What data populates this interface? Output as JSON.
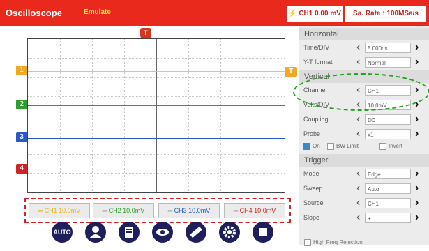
{
  "header": {
    "title": "Oscilloscope",
    "mode": "Emulate",
    "ch1_readout": "CH1 0.00 mV",
    "sample_rate": "Sa. Rate : 100MSa/s"
  },
  "trigger_marker": "T",
  "trigger_level_marker": "T",
  "channels": [
    {
      "tag": "1",
      "color": "#f5a623"
    },
    {
      "tag": "2",
      "color": "#2e9e2e"
    },
    {
      "tag": "3",
      "color": "#2a59c9"
    },
    {
      "tag": "4",
      "color": "#d62222"
    }
  ],
  "channel_buttons": [
    {
      "label": "CH1 10.0mV",
      "color": "#f5c542"
    },
    {
      "label": "CH2 10.0mV",
      "color": "#2e9e2e"
    },
    {
      "label": "CH3 10.0mV",
      "color": "#2a59c9"
    },
    {
      "label": "CH4 10.0mV",
      "color": "#d62222"
    }
  ],
  "toolbar": [
    {
      "name": "auto-button",
      "label": "AUTO"
    },
    {
      "name": "user-icon",
      "label": ""
    },
    {
      "name": "save-icon",
      "label": ""
    },
    {
      "name": "eye-icon",
      "label": ""
    },
    {
      "name": "ruler-icon",
      "label": ""
    },
    {
      "name": "gear-icon",
      "label": ""
    },
    {
      "name": "stop-icon",
      "label": ""
    }
  ],
  "panel": {
    "horizontal": {
      "heading": "Horizontal",
      "rows": [
        {
          "label": "Time/DIV",
          "value": "5.000ns"
        },
        {
          "label": "Y-T format",
          "value": "Normal"
        }
      ]
    },
    "vertical": {
      "heading": "Vertical",
      "rows": [
        {
          "label": "Channel",
          "value": "CH1"
        },
        {
          "label": "Volts/DIV",
          "value": "10.0mV"
        },
        {
          "label": "Coupling",
          "value": "DC"
        },
        {
          "label": "Probe",
          "value": "x1"
        }
      ],
      "checks": {
        "on": "On",
        "bw_limit": "BW Limit",
        "invert": "Invert"
      }
    },
    "trigger": {
      "heading": "Trigger",
      "rows": [
        {
          "label": "Mode",
          "value": "Edge"
        },
        {
          "label": "Sweep",
          "value": "Auto"
        },
        {
          "label": "Source",
          "value": "CH1"
        },
        {
          "label": "Slope",
          "value": "+"
        }
      ]
    },
    "high_freq": "High Freq Rejection"
  }
}
